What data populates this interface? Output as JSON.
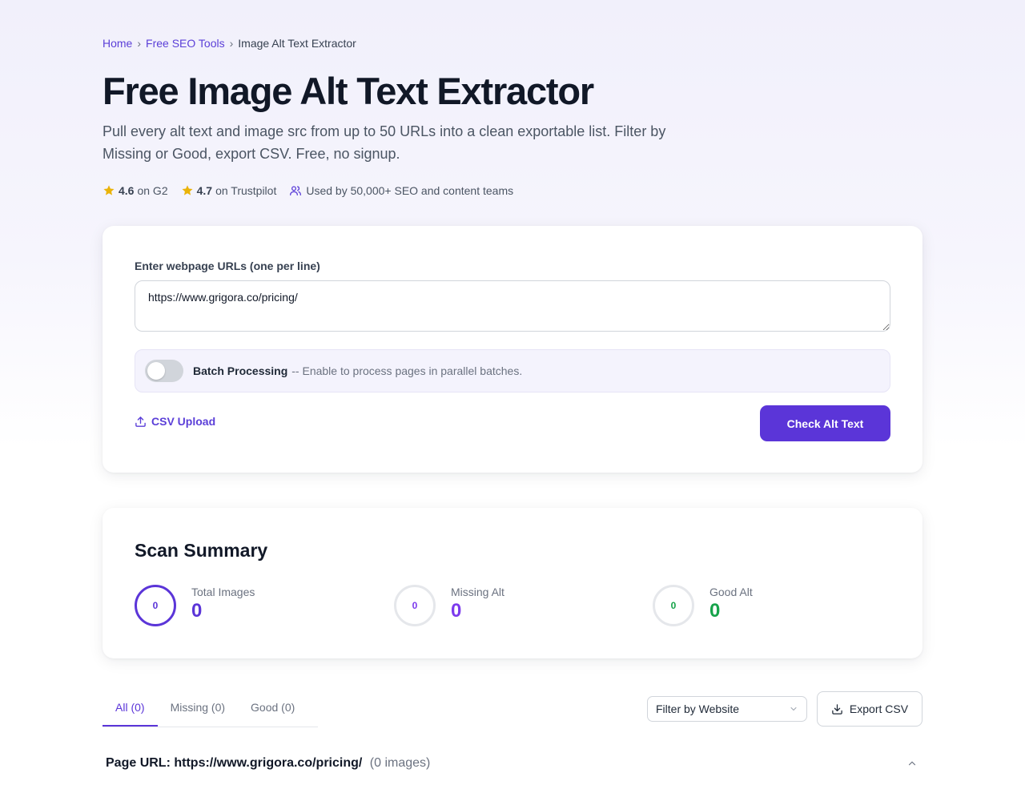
{
  "breadcrumb": {
    "items": [
      {
        "label": "Home"
      },
      {
        "label": "Free SEO Tools"
      },
      {
        "label": "Image Alt Text Extractor"
      }
    ],
    "separator": "›"
  },
  "hero": {
    "title": "Free Image Alt Text Extractor",
    "subtitle": "Pull every alt text and image src from up to 50 URLs into a clean exportable list. Filter by Missing or Good, export CSV. Free, no signup."
  },
  "ratings": [
    {
      "score": "4.6",
      "source": "on G2",
      "icon": "star-icon"
    },
    {
      "score": "4.7",
      "source": "on Trustpilot",
      "icon": "star-icon"
    }
  ],
  "social_proof": {
    "text": "Used by 50,000+ SEO and content teams",
    "icon": "users-icon"
  },
  "input_card": {
    "label": "Enter webpage URLs (one per line)",
    "url_value": "https://www.grigora.co/pricing/",
    "batch": {
      "title": "Batch Processing",
      "description": "-- Enable to process pages in parallel batches.",
      "enabled": false
    },
    "csv_upload_label": "CSV Upload",
    "submit_label": "Check Alt Text"
  },
  "summary": {
    "title": "Scan Summary",
    "stats": [
      {
        "label": "Total Images",
        "value": "0",
        "ring_value": "0"
      },
      {
        "label": "Missing Alt",
        "value": "0",
        "ring_value": "0"
      },
      {
        "label": "Good Alt",
        "value": "0",
        "ring_value": "0"
      }
    ]
  },
  "results": {
    "tabs": [
      {
        "label": "All (0)",
        "active": true
      },
      {
        "label": "Missing (0)",
        "active": false
      },
      {
        "label": "Good (0)",
        "active": false
      }
    ],
    "filter_label": "Filter by Website",
    "export_label": "Export CSV",
    "page_row": {
      "label": "Page URL:",
      "url": "https://www.grigora.co/pricing/",
      "count": "(0 images)"
    }
  },
  "colors": {
    "accent": "#5b35d8",
    "missing": "#7c3aed",
    "good": "#16a34a",
    "star": "#eab308"
  }
}
